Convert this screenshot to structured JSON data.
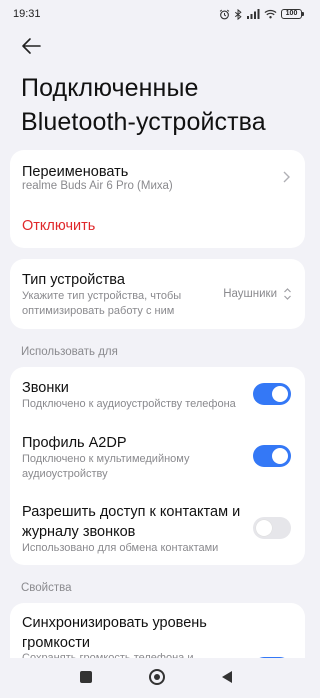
{
  "status_bar": {
    "time": "19:31",
    "battery": "100"
  },
  "page": {
    "title": "Подключенные Bluetooth-устройства"
  },
  "device_card": {
    "rename_label": "Переименовать",
    "device_name": "realme Buds Air 6 Pro (Миха)",
    "disconnect_label": "Отключить",
    "disconnect_color": "#e0282b"
  },
  "device_type_card": {
    "title": "Тип устройства",
    "subtitle": "Укажите тип устройства, чтобы оптимизировать работу с ним",
    "selected_value": "Наушники"
  },
  "use_for": {
    "section_label": "Использовать для",
    "items": [
      {
        "title": "Звонки",
        "subtitle": "Подключено к аудиоустройству телефона",
        "enabled": true
      },
      {
        "title": "Профиль A2DP",
        "subtitle": "Подключено к мультимедийному аудиоустройству",
        "enabled": true
      },
      {
        "title": "Разрешить доступ к контактам и журналу звонков",
        "subtitle": "Использовано для обмена контактами",
        "enabled": false
      }
    ]
  },
  "properties": {
    "section_label": "Свойства",
    "items": [
      {
        "title": "Синхронизировать уровень громкости",
        "subtitle": "Сохранять громкость телефона и",
        "enabled": true
      }
    ]
  },
  "colors": {
    "accent": "#3478f6",
    "background": "#f2f2f7",
    "card": "#ffffff"
  }
}
